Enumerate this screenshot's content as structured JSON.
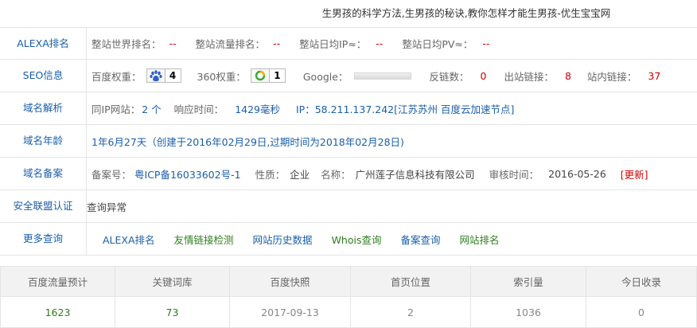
{
  "page_title": "生男孩的科学方法,生男孩的秘诀,教你怎样才能生男孩-优生宝宝网",
  "rows": {
    "alexa": {
      "label": "ALEXA排名",
      "world_rank_label": "整站世界排名：",
      "world_rank_value": "--",
      "traffic_rank_label": "整站流量排名：",
      "traffic_rank_value": "--",
      "daily_ip_label": "整站日均IP≈：",
      "daily_ip_value": "--",
      "daily_pv_label": "整站日均PV≈：",
      "daily_pv_value": "--"
    },
    "seo": {
      "label": "SEO信息",
      "baidu_weight_label": "百度权重：",
      "baidu_weight_value": "4",
      "weight360_label": "360权重：",
      "weight360_value": "1",
      "google_label": "Google：",
      "backlinks_label": "反链数：",
      "backlinks_value": "0",
      "outlinks_label": "出站链接：",
      "outlinks_value": "8",
      "inlinks_label": "站内链接：",
      "inlinks_value": "37"
    },
    "dns": {
      "label": "域名解析",
      "same_ip_label": "同IP网站：",
      "same_ip_value": "2 个",
      "response_label": "响应时间：",
      "response_value": "1429毫秒",
      "ip_text": "IP：58.211.137.242[江苏苏州 百度云加速节点]"
    },
    "age": {
      "label": "域名年龄",
      "value": "1年6月27天（创建于2016年02月29日,过期时间为2018年02月28日)"
    },
    "icp": {
      "label": "域名备案",
      "number_label": "备案号：",
      "number_value": "粤ICP备16033602号-1",
      "nature_label": "性质：",
      "nature_value": "企业",
      "name_label": "名称：",
      "name_value": "广州莲子信息科技有限公司",
      "audit_label": "审核时间：",
      "audit_value": "2016-05-26",
      "update_label": "[更新]"
    },
    "security": {
      "label": "安全联盟认证",
      "value": "查询异常"
    },
    "more": {
      "label": "更多查询",
      "links": [
        "ALEXA排名",
        "友情链接检测",
        "网站历史数据",
        "Whois查询",
        "备案查询",
        "网站排名"
      ]
    }
  },
  "stats": {
    "headers": [
      "百度流量预计",
      "关键词库",
      "百度快照",
      "首页位置",
      "索引量",
      "今日收录"
    ],
    "values": [
      "1623",
      "73",
      "2017-09-13",
      "2",
      "1036",
      "0"
    ]
  },
  "colors": {
    "label_blue": "#1a5fa8",
    "value_red": "#cc0000",
    "link_green": "#2e7d1e"
  }
}
